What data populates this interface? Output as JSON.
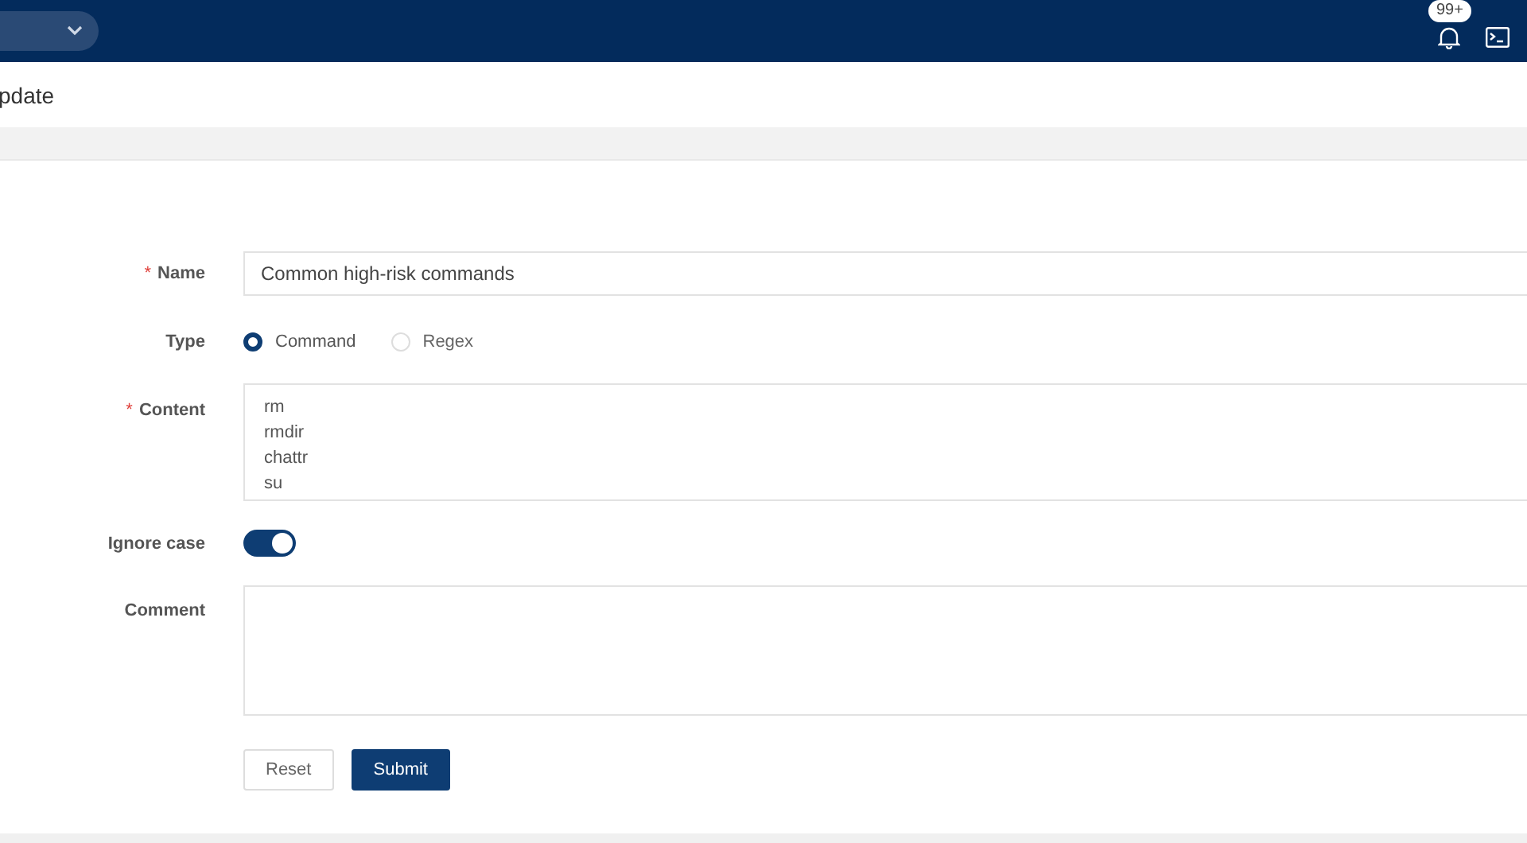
{
  "header": {
    "notifications": {
      "badge": "99+"
    }
  },
  "page": {
    "title": "pdate"
  },
  "form": {
    "name": {
      "label": "Name",
      "required_mark": "*",
      "value": "Common high-risk commands"
    },
    "type": {
      "label": "Type",
      "options": [
        {
          "label": "Command",
          "selected": true
        },
        {
          "label": "Regex",
          "selected": false
        }
      ]
    },
    "content": {
      "label": "Content",
      "required_mark": "*",
      "lines": [
        "rm",
        "rmdir",
        "chattr",
        "su"
      ]
    },
    "ignore_case": {
      "label": "Ignore case",
      "on": true
    },
    "comment": {
      "label": "Comment"
    },
    "buttons": [
      {
        "label": "Reset",
        "kind": "secondary"
      },
      {
        "label": "Submit",
        "kind": "primary"
      }
    ]
  }
}
